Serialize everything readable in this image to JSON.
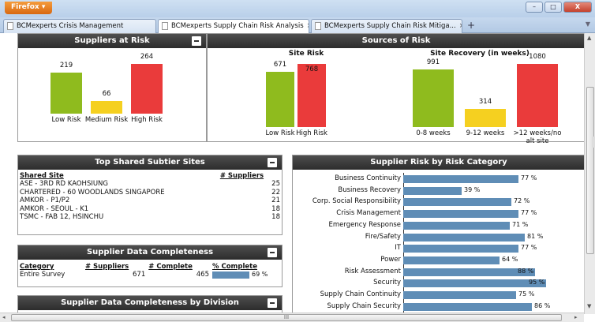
{
  "browser": {
    "menu_label": "Firefox ▾",
    "tabs": [
      {
        "label": "BCMexperts Crisis Management"
      },
      {
        "label": "BCMexperts Supply Chain Risk Analysis",
        "close": "×"
      },
      {
        "label": "BCMexperts Supply Chain Risk Mitiga...",
        "close": "×"
      }
    ],
    "new_tab": "+",
    "window_buttons": {
      "minimize": "–",
      "maximize": "□",
      "close": "X"
    }
  },
  "suppliers_at_risk": {
    "title": "Suppliers at Risk",
    "chart_data": {
      "type": "bar",
      "categories": [
        "Low Risk",
        "Medium Risk",
        "High Risk"
      ],
      "values": [
        219,
        66,
        264
      ],
      "colors": [
        "#8fbb1e",
        "#f5d020",
        "#ea3b3b"
      ]
    }
  },
  "sources_of_risk": {
    "title": "Sources of Risk",
    "site_risk": {
      "title": "Site Risk",
      "chart_data": {
        "type": "bar",
        "categories": [
          "Low Risk",
          "High Risk"
        ],
        "values": [
          671,
          768
        ],
        "colors": [
          "#8fbb1e",
          "#ea3b3b"
        ]
      }
    },
    "site_recovery": {
      "title": "Site Recovery (in weeks)",
      "chart_data": {
        "type": "bar",
        "categories": [
          "0-8 weeks",
          "9-12 weeks",
          ">12 weeks/no alt site"
        ],
        "values": [
          991,
          314,
          1080
        ],
        "colors": [
          "#8fbb1e",
          "#f5d020",
          "#ea3b3b"
        ]
      }
    }
  },
  "top_shared_sites": {
    "title": "Top Shared Subtier Sites",
    "headers": [
      "Shared Site",
      "# Suppliers"
    ],
    "rows": [
      [
        "ASE - 3RD RD KAOHSIUNG",
        "25"
      ],
      [
        "CHARTERED - 60 WOODLANDS SINGAPORE",
        "22"
      ],
      [
        "AMKOR - P1/P2",
        "21"
      ],
      [
        "AMKOR - SEOUL - K1",
        "18"
      ],
      [
        "TSMC - FAB 12, HSINCHU",
        "18"
      ]
    ]
  },
  "data_completeness": {
    "title": "Supplier Data Completeness",
    "headers": [
      "Category",
      "# Suppliers",
      "# Complete",
      "% Complete"
    ],
    "rows": [
      {
        "category": "Entire Survey",
        "suppliers": "671",
        "complete": "465",
        "pct_label": "69 %",
        "pct": 69
      }
    ]
  },
  "completeness_by_division": {
    "title": "Supplier Data Completeness by Division"
  },
  "risk_by_category": {
    "title": "Supplier Risk by Risk Category",
    "chart_data": {
      "type": "bar",
      "orientation": "horizontal",
      "categories": [
        "Business Continuity",
        "Business Recovery",
        "Corp. Social Responsibility",
        "Crisis Management",
        "Emergency Response",
        "Fire/Safety",
        "IT",
        "Power",
        "Risk Assessment",
        "Security",
        "Supply Chain Continuity",
        "Supply Chain Security"
      ],
      "values": [
        77,
        39,
        72,
        77,
        71,
        81,
        77,
        64,
        88,
        95,
        75,
        86
      ],
      "value_labels": [
        "77 %",
        "39 %",
        "72 %",
        "77 %",
        "71 %",
        "81 %",
        "77 %",
        "64 %",
        "88 %",
        "95 %",
        "75 %",
        "86 %"
      ],
      "xlim": [
        0,
        100
      ],
      "color": "#5f8db6"
    }
  },
  "scrollbar": {
    "up": "▲",
    "down": "▼",
    "left": "◂",
    "right": "▸",
    "grip": "III"
  }
}
